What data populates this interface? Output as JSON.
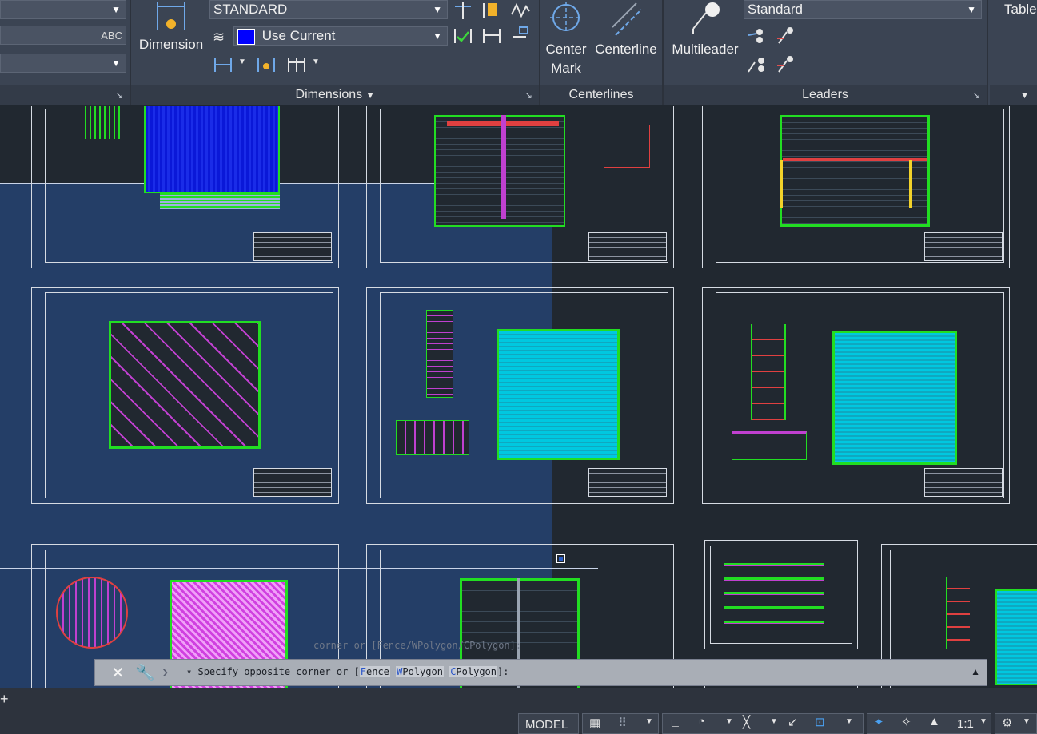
{
  "ribbon": {
    "annotation": {
      "dimension_label": "Dimension",
      "dim_style": "STANDARD",
      "layer_value": "Use Current",
      "layer_color": "#0000ff",
      "title": "Dimensions"
    },
    "centerlines": {
      "center_mark_label": "Center Mark",
      "centerline_label": "Centerline",
      "title": "Centerlines"
    },
    "leaders": {
      "multileader_label": "Multileader",
      "style": "Standard",
      "title": "Leaders"
    },
    "table": {
      "label": "Table"
    }
  },
  "command_line": {
    "history": "corner or [Fence/WPolygon/CPolygon]:",
    "prompt": "Specify opposite corner or [",
    "options": [
      {
        "key": "F",
        "rest": "ence"
      },
      {
        "key": "W",
        "rest": "Polygon"
      },
      {
        "key": "C",
        "rest": "Polygon"
      }
    ],
    "suffix": "]:"
  },
  "status_bar": {
    "model_label": "MODEL",
    "scale": "1:1"
  },
  "colors": {
    "ribbon_bg": "#3b4453",
    "canvas_bg": "#212830",
    "selection_window": "#28509680",
    "geometry_green": "#22dd22",
    "hatch_blue": "#0a18d8",
    "hatch_cyan": "#00c8e0",
    "hatch_magenta": "#d040e0"
  }
}
